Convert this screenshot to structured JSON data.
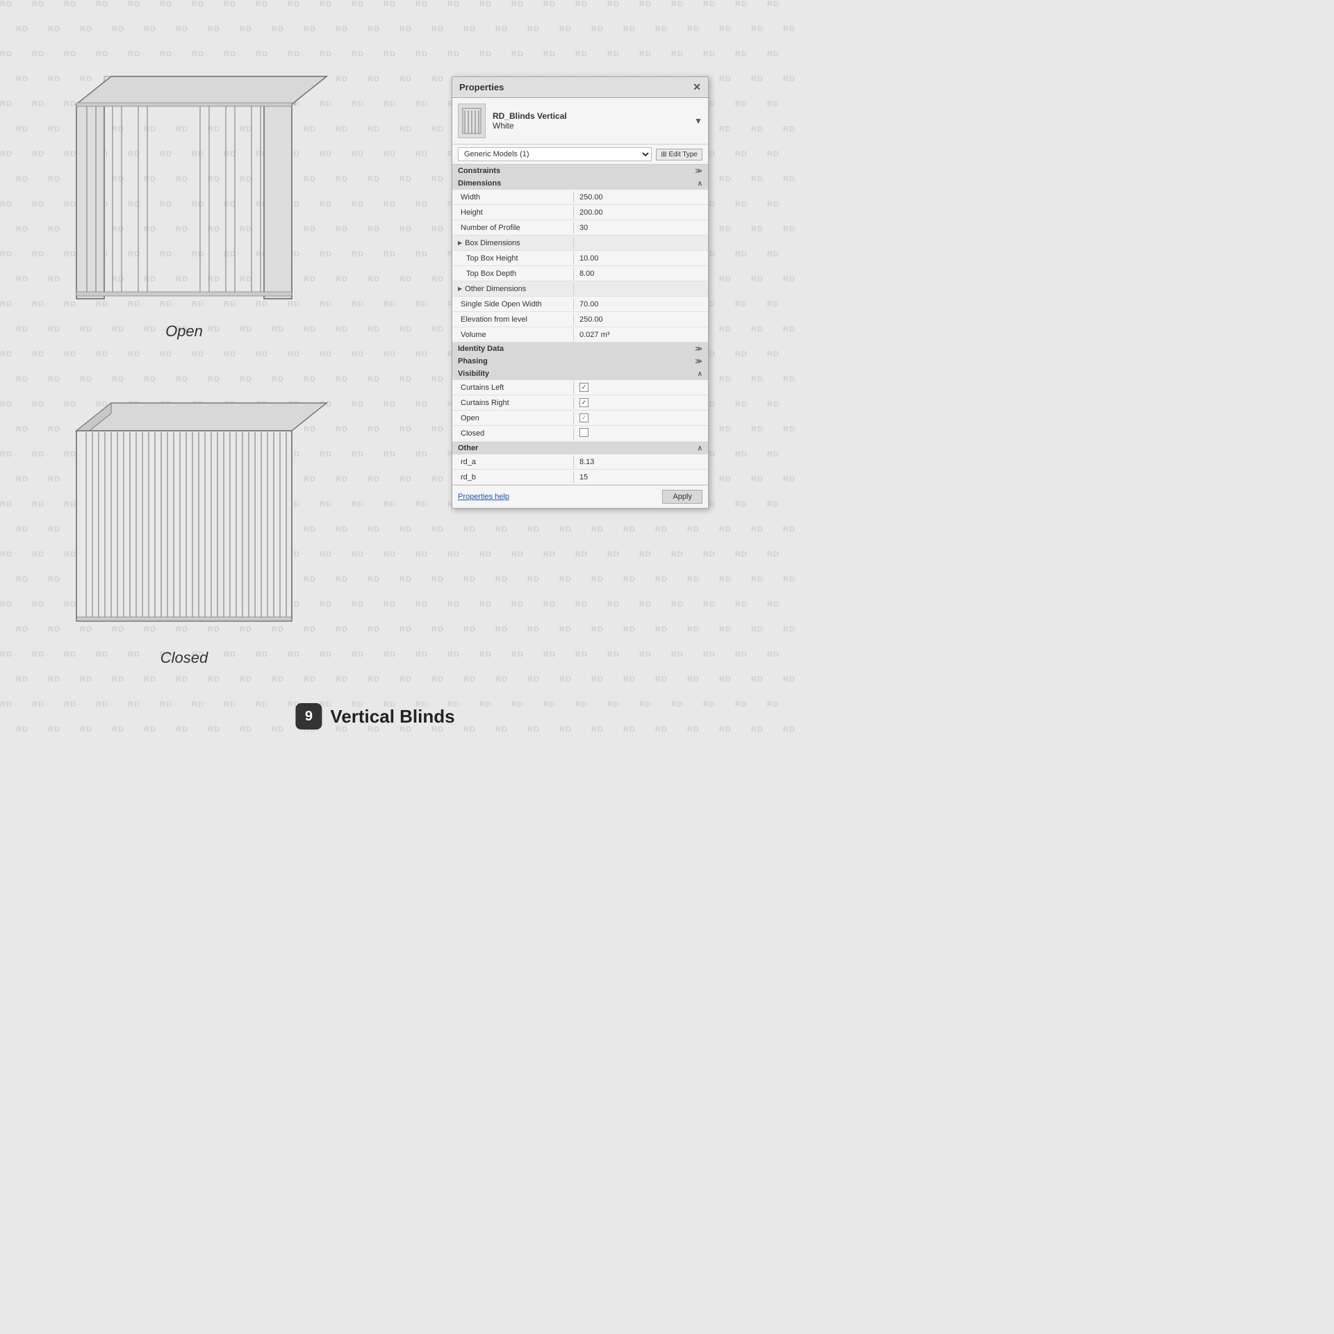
{
  "watermark": "RD",
  "panel": {
    "title": "Properties",
    "close_label": "✕",
    "object": {
      "name": "RD_Blinds Vertical",
      "subname": "White"
    },
    "type_selector": {
      "value": "Generic Models (1)",
      "edit_button": "⊞ Edit Type"
    },
    "sections": {
      "constraints": "Constraints",
      "dimensions": "Dimensions",
      "identity_data": "Identity Data",
      "phasing": "Phasing",
      "visibility": "Visibility",
      "other": "Other"
    },
    "properties": {
      "width": {
        "label": "Width",
        "value": "250.00"
      },
      "height": {
        "label": "Height",
        "value": "200.00"
      },
      "number_of_profile": {
        "label": "Number of Profile",
        "value": "30"
      },
      "box_dimensions": {
        "label": "Box Dimensions",
        "expandable": true
      },
      "top_box_height": {
        "label": "Top Box Height",
        "value": "10.00"
      },
      "top_box_depth": {
        "label": "Top Box Depth",
        "value": "8.00"
      },
      "other_dimensions": {
        "label": "Other Dimensions",
        "expandable": true
      },
      "single_side_open_width": {
        "label": "Single Side Open Width",
        "value": "70.00"
      },
      "elevation_from_level": {
        "label": "Elevation from level",
        "value": "250.00"
      },
      "volume": {
        "label": "Volume",
        "value": "0.027 m³"
      },
      "curtains_left": {
        "label": "Curtains Left",
        "checked": true
      },
      "curtains_right": {
        "label": "Curtains Right",
        "checked": true
      },
      "open": {
        "label": "Open",
        "checked_indeterminate": true
      },
      "closed": {
        "label": "Closed",
        "checked": false
      },
      "rd_a": {
        "label": "rd_a",
        "value": "8.13"
      },
      "rd_b": {
        "label": "rd_b",
        "value": "15"
      }
    },
    "bottom": {
      "help_link": "Properties help",
      "apply_button": "Apply"
    }
  },
  "diagrams": {
    "open_label": "Open",
    "closed_label": "Closed"
  },
  "footer": {
    "number": "9",
    "title": "Vertical Blinds"
  }
}
